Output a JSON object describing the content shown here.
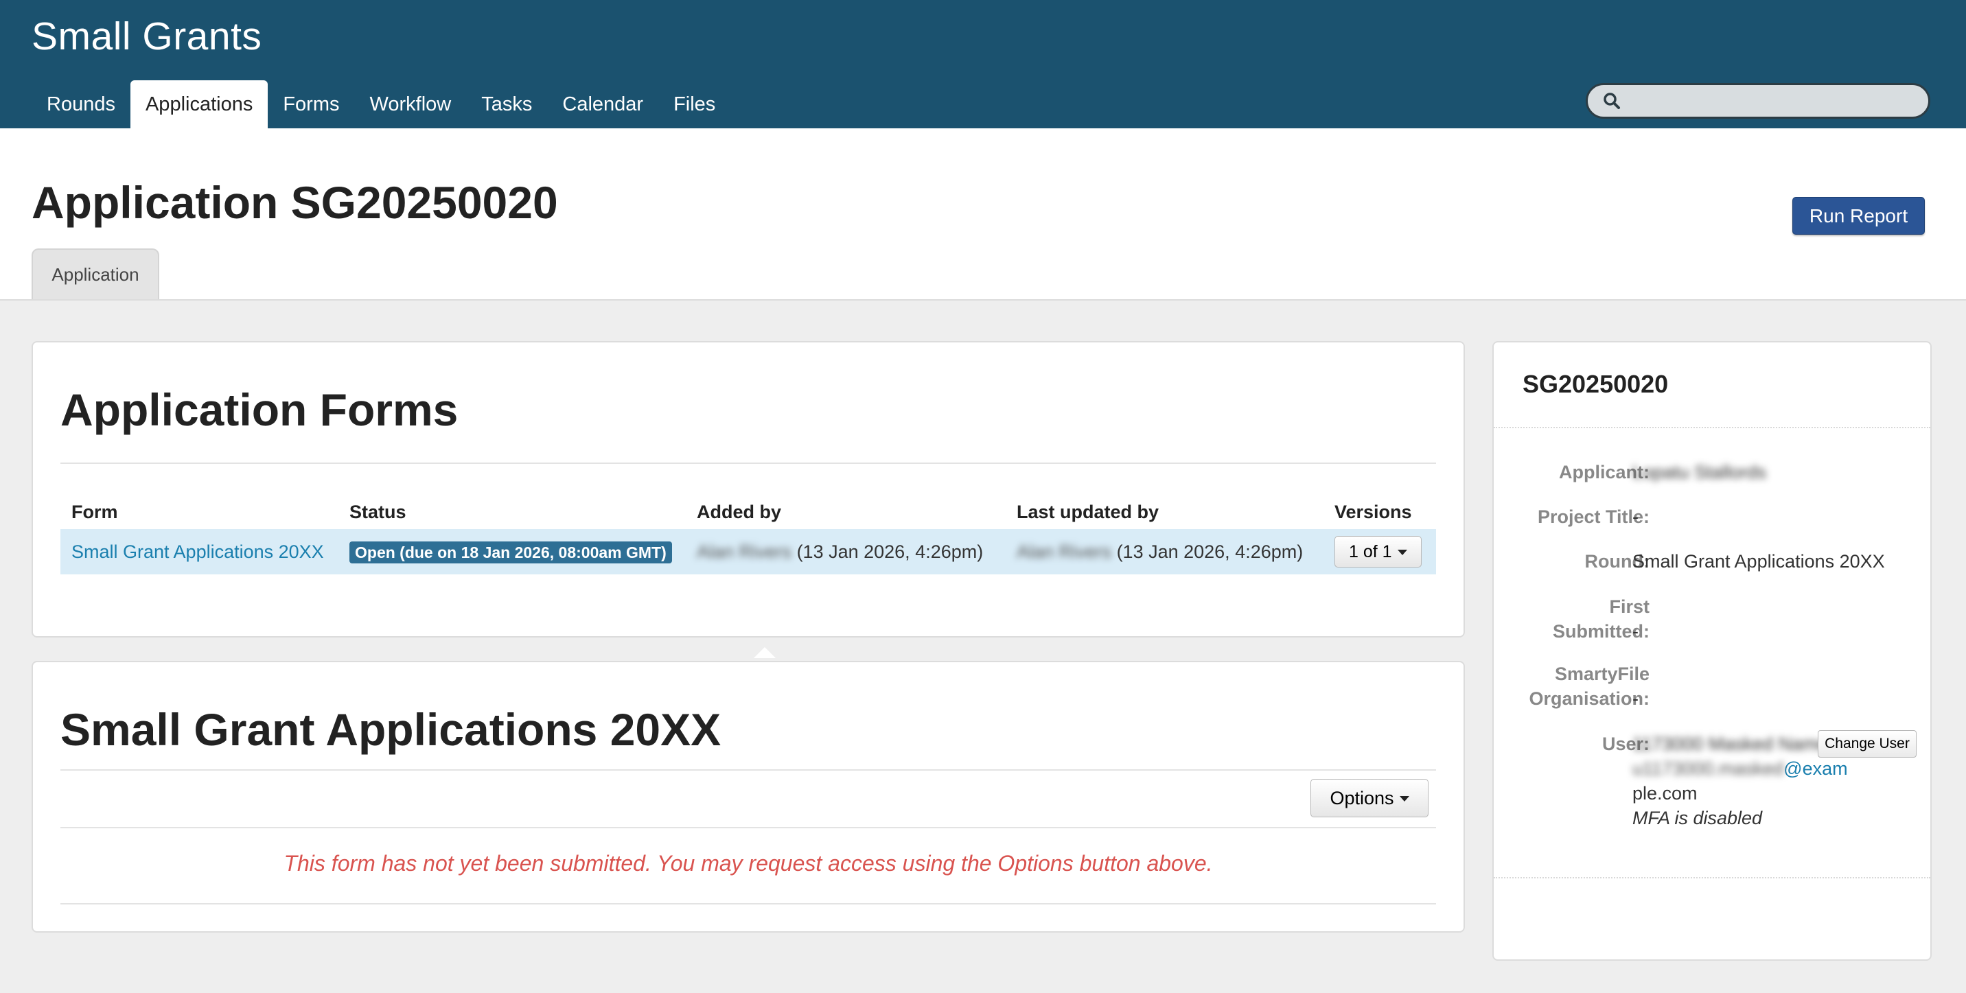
{
  "app": {
    "title": "Small Grants"
  },
  "nav": {
    "items": [
      "Rounds",
      "Applications",
      "Forms",
      "Workflow",
      "Tasks",
      "Calendar",
      "Files"
    ],
    "active": "Applications"
  },
  "search": {
    "placeholder": "",
    "value": ""
  },
  "page": {
    "title": "Application SG20250020",
    "run_report_label": "Run Report",
    "tab_label": "Application"
  },
  "forms_panel": {
    "title": "Application Forms",
    "headers": {
      "form": "Form",
      "status": "Status",
      "added_by": "Added by",
      "last_updated_by": "Last updated by",
      "versions": "Versions"
    },
    "row": {
      "form": "Small Grant Applications 20XX",
      "status": "Open (due on 18 Jan 2026, 08:00am GMT)",
      "added_by_name": "Alan Rivers",
      "added_by_date": "(13 Jan 2026, 4:26pm)",
      "updated_by_name": "Alan Rivers",
      "updated_by_date": "(13 Jan 2026, 4:26pm)",
      "versions": "1 of 1"
    }
  },
  "grant_panel": {
    "title": "Small Grant Applications 20XX",
    "options_label": "Options",
    "message": "This form has not yet been submitted. You may request access using the Options button above."
  },
  "sidebar": {
    "title": "SG20250020",
    "applicant_label": "Applicant:",
    "applicant_value": "Lopatu Stallords",
    "project_title_label": "Project Title:",
    "project_title_value": "-",
    "round_label": "Round:",
    "round_value": "Small Grant Applications 20XX",
    "first_label_1": "First",
    "first_label_2": "Submitted:",
    "first_value": "-",
    "org_label_1": "SmartyFile",
    "org_label_2": "Organisation:",
    "org_value": "-",
    "user_label": "User:",
    "user_name": "1173000 Masked Name",
    "change_user_label": "Change User",
    "email_blur": "u1173000.masked",
    "email_part1": "@exam",
    "email_part2": "ple.com",
    "mfa_text": "MFA is disabled"
  },
  "colors": {
    "header_bg": "#1b526f",
    "primary_button": "#2b5596",
    "link": "#1a7fae",
    "status_badge": "#2e6f95",
    "warning_text": "#d9534f"
  }
}
